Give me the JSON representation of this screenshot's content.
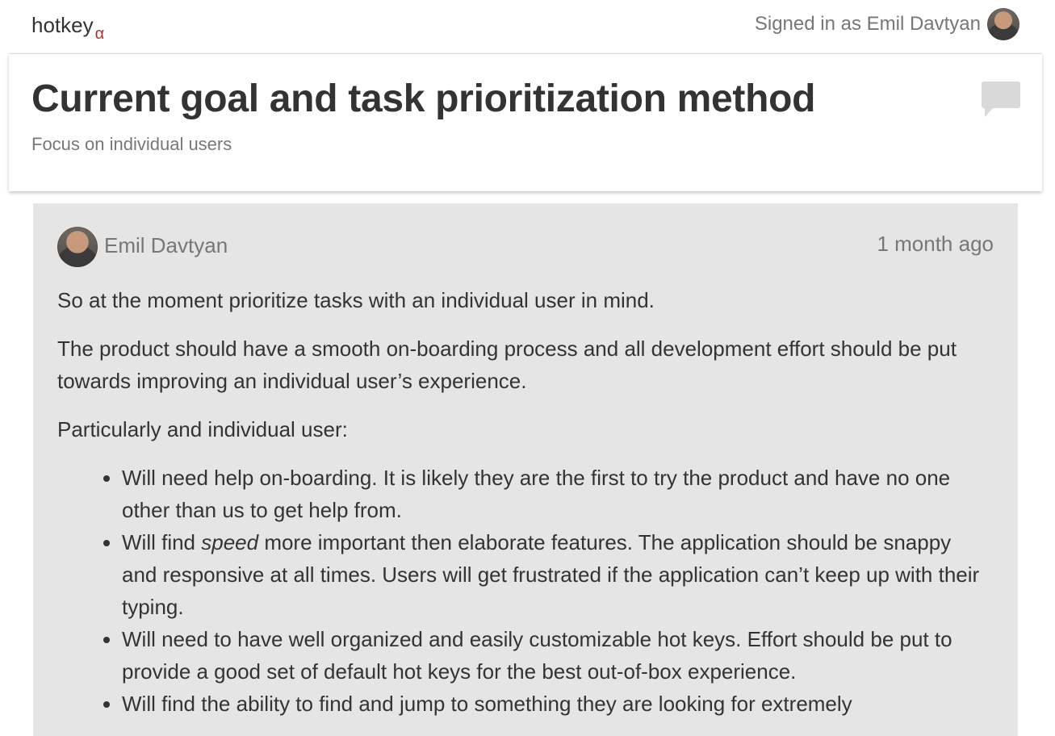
{
  "topbar": {
    "logo_text": "hotkey",
    "logo_sub": "α",
    "signed_in_text": "Signed in as Emil Davtyan"
  },
  "header": {
    "title": "Current goal and task prioritization method",
    "subtitle": "Focus on individual users",
    "comment_icon": "speech-bubble-icon"
  },
  "post": {
    "author": "Emil Davtyan",
    "time": "1 month ago",
    "paragraphs": [
      "So at the moment prioritize tasks with an individual user in mind.",
      "The product should have a smooth on-boarding process and all development effort should be put towards improving an individual user’s experience.",
      "Particularly and individual user:"
    ],
    "bullets": [
      "Will need help on-boarding. It is likely they are the first to try the product and have no one other than us to get help from.",
      {
        "before": "Will find ",
        "em": "speed",
        "after": " more important then elaborate features. The application should be snappy and responsive at all times. Users will get frustrated if the application can’t keep up with their typing."
      },
      "Will need to have well organized and easily customizable hot keys. Effort should be put to provide a good set of default hot keys for the best out-of-box experience.",
      "Will find the ability to find and jump to something they are looking for extremely"
    ]
  },
  "colors": {
    "brand_accent": "#b3312f",
    "post_background": "#e5e5e5",
    "muted_text": "#777777",
    "body_text": "#333333"
  }
}
